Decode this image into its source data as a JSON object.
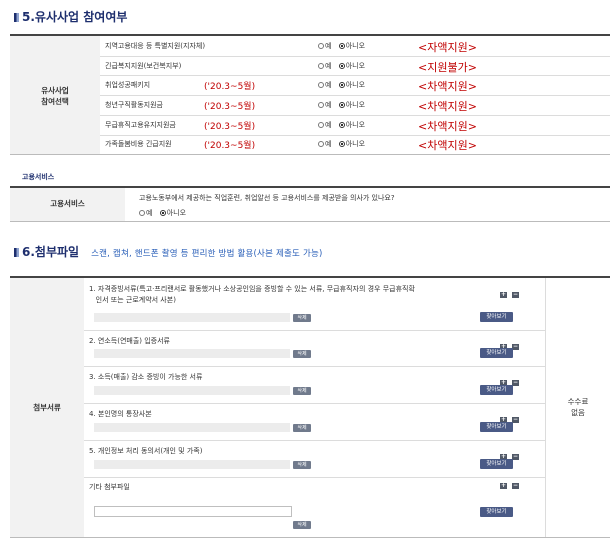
{
  "section5": {
    "title": "5.유사사업 참여여부",
    "label": "유사사업\n참여선택",
    "rows": [
      {
        "name": "지역고용대응 등 특별지원(지자체)",
        "period": "",
        "yes": "예",
        "no": "아니오",
        "selected": "no",
        "support": "<자액지원>"
      },
      {
        "name": "긴급복지지원(보건복지부)",
        "period": "",
        "yes": "예",
        "no": "아니오",
        "selected": "no",
        "support": "<지원불가>"
      },
      {
        "name": "취업성공패키지",
        "period": "('20.3~5월)",
        "yes": "예",
        "no": "아니오",
        "selected": "no",
        "support": "<차액지원>"
      },
      {
        "name": "청년구직활동지원금",
        "period": "('20.3~5월)",
        "yes": "예",
        "no": "아니오",
        "selected": "no",
        "support": "<차액지원>"
      },
      {
        "name": "무급휴직고용유지지원금",
        "period": "('20.3~5월)",
        "yes": "예",
        "no": "아니오",
        "selected": "no",
        "support": "<차액지원>"
      },
      {
        "name": "가족돌봄비용 긴급지원",
        "period": "('20.3~5월)",
        "yes": "예",
        "no": "아니오",
        "selected": "no",
        "support": "<차액지원>"
      }
    ]
  },
  "employment": {
    "small_title": "고용서비스",
    "label": "고용서비스",
    "question": "고용노동부에서 제공하는 직업훈련, 취업알선 등 고용서비스를 제공받을 의사가 있나요?",
    "yes": "예",
    "no": "아니오",
    "selected": "no"
  },
  "section6": {
    "title": "6.첨부파일",
    "subtitle": "스캔, 캡쳐, 핸드폰 촬영 등 편리한 방법 활용(사본 제출도 가능)",
    "label": "첨부서류",
    "fee_label": "수수료\n없음",
    "delete_label": "삭제",
    "find_label": "찾아보기",
    "plus_label": "+",
    "minus_label": "−",
    "items": [
      {
        "text": "1. 자격증빙서류(특고·프리랜서로 활동했거나 소상공인임을 증빙할 수 있는 서류, 무급휴직자의 경우 무급휴직확\n   인서 또는 근로계약서 사본)"
      },
      {
        "text": "2. 연소득(연매출) 입증서류"
      },
      {
        "text": "3. 소득(매출) 감소 증빙이 가능한 서류"
      },
      {
        "text": "4. 본인명의 통장사본"
      },
      {
        "text": "5. 개인정보 처리 동의서(개인 및 가족)"
      }
    ],
    "other": {
      "text": "기타 첨부파일"
    }
  },
  "colors": {
    "title": "#1e2f6e",
    "red": "#c00000",
    "link_blue": "#2a5fb8",
    "button": "#4a5a86"
  }
}
